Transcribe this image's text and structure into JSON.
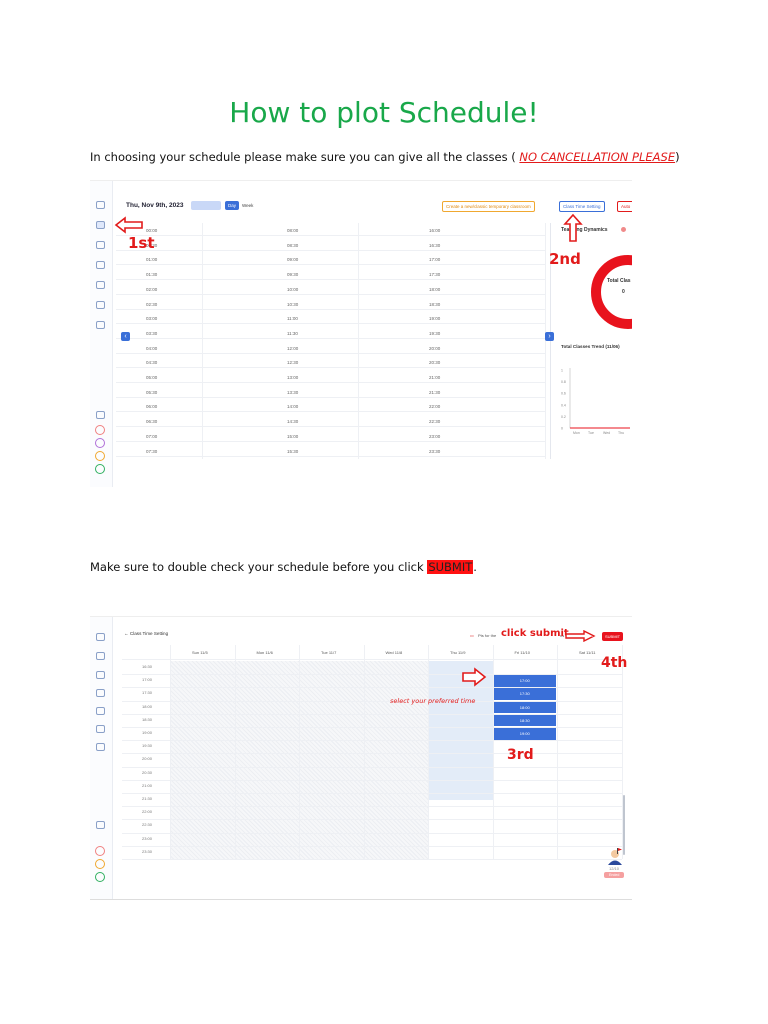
{
  "title": "How to plot Schedule!",
  "intro": {
    "before": "In choosing your schedule please make sure you can give all the classes ( ",
    "warning": "NO CANCELLATION PLEASE",
    "after": ")"
  },
  "outro": {
    "before": "Make sure to double check your schedule before you click ",
    "highlight": "SUBMIT",
    "after": "."
  },
  "shot1": {
    "date": "Thu, Nov 9th, 2023",
    "today_btn": "Today",
    "day_btn": "Day",
    "week_btn": "Week",
    "create_btn": "Create a new/classic temporary classroom",
    "class_time_btn": "Class Time Setting",
    "auto_btn": "Auto",
    "teaching_dynamics": "Teaching Dynamics",
    "total_classes": "Total Clas",
    "total_value": "0",
    "trend_label": "Total Classes Trend (11/06)",
    "trend_yticks": [
      "1",
      "0.8",
      "0.6",
      "0.4",
      "0.2",
      "0"
    ],
    "trend_xticks": [
      "Mon",
      "Tue",
      "Wed",
      "Thu"
    ],
    "times_col1": [
      "00:00",
      "00:30",
      "01:00",
      "01:30",
      "02:00",
      "02:30",
      "03:00",
      "03:30",
      "04:00",
      "04:30",
      "05:00",
      "05:30",
      "06:00",
      "06:30",
      "07:00",
      "07:30"
    ],
    "times_col2": [
      "08:00",
      "08:30",
      "09:00",
      "09:30",
      "10:00",
      "10:30",
      "11:00",
      "11:30",
      "12:00",
      "12:30",
      "13:00",
      "13:30",
      "14:00",
      "14:30",
      "15:00",
      "15:30"
    ],
    "times_col3": [
      "16:00",
      "16:30",
      "17:00",
      "17:30",
      "18:00",
      "18:30",
      "19:00",
      "19:30",
      "20:00",
      "20:30",
      "21:00",
      "21:30",
      "22:00",
      "22:30",
      "23:00",
      "23:30"
    ],
    "ann_first": "1st",
    "ann_second": "2nd"
  },
  "shot2": {
    "back_label": "Class Time Setting",
    "days": [
      "Sun 11/5",
      "Mon 11/6",
      "Tue 11/7",
      "Wed 11/8",
      "Thu 11/9",
      "Fri 11/10",
      "Sat 11/11"
    ],
    "times": [
      "16:30",
      "17:00",
      "17:30",
      "18:00",
      "18:30",
      "19:00",
      "19:30",
      "20:00",
      "20:30",
      "21:00",
      "21:30",
      "22:00",
      "22:30",
      "23:00",
      "23:30"
    ],
    "selected_slots": [
      "17:00",
      "17:30",
      "18:00",
      "18:30",
      "19:00"
    ],
    "points_note": "Pts for the",
    "points_tail": "ns",
    "submit_btn": "SUBMIT",
    "ann_click": "click submit",
    "ann_select": "select your preferred time",
    "ann_third": "3rd",
    "ann_fourth": "4th",
    "avatar_caption": "12/10",
    "badge": "Ended"
  },
  "colors": {
    "title": "#19a84a",
    "warning": "#e21b1b",
    "highlight": "#ff1111",
    "accent": "#3a6fd8"
  }
}
